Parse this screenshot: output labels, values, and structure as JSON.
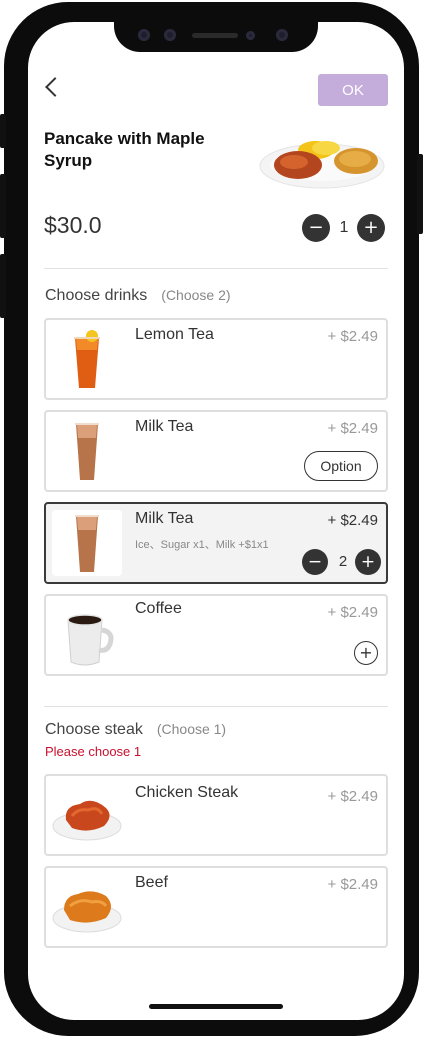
{
  "header": {
    "ok_label": "OK"
  },
  "product": {
    "title": "Pancake with Maple Syrup",
    "price": "$30.0",
    "quantity": "1"
  },
  "drinks": {
    "title": "Choose drinks",
    "hint": "(Choose 2)",
    "items": [
      {
        "name": "Lemon Tea",
        "price": "+ $2.49"
      },
      {
        "name": "Milk Tea",
        "price": "+ $2.49",
        "action": "Option"
      },
      {
        "name": "Milk Tea",
        "price": "+ $2.49",
        "options": "Ice、Sugar x1、Milk +$1x1",
        "quantity": "2"
      },
      {
        "name": "Coffee",
        "price": "+ $2.49"
      }
    ]
  },
  "steak": {
    "title": "Choose steak",
    "hint": "(Choose 1)",
    "warning": "Please choose 1",
    "items": [
      {
        "name": "Chicken Steak",
        "price": "+ $2.49"
      },
      {
        "name": "Beef",
        "price": "+ $2.49"
      }
    ]
  },
  "colors": {
    "accent": "#c4addb",
    "dark": "#333333",
    "warning": "#c8102e"
  }
}
